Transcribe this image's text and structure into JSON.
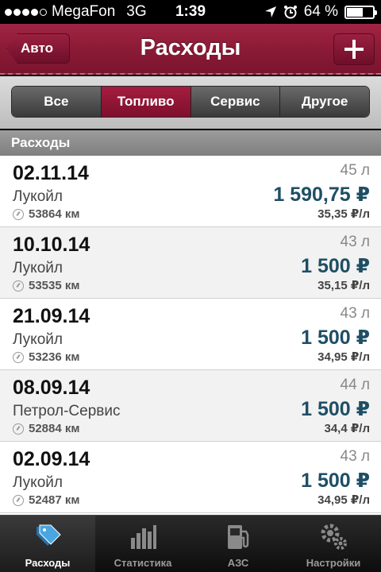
{
  "status_bar": {
    "carrier": "MegaFon",
    "network": "3G",
    "time": "1:39",
    "battery": "64 %",
    "battery_level": 0.64,
    "signal_bars": 4
  },
  "nav": {
    "back_label": "Авто",
    "title": "Расходы",
    "add_icon": "plus-icon"
  },
  "segments": [
    {
      "label": "Все",
      "active": false
    },
    {
      "label": "Топливо",
      "active": true
    },
    {
      "label": "Сервис",
      "active": false
    },
    {
      "label": "Другое",
      "active": false
    }
  ],
  "section_header": "Расходы",
  "expenses": [
    {
      "date": "02.11.14",
      "station": "Лукойл",
      "odometer": "53864 км",
      "volume": "45 л",
      "amount": "1 590,75 ₽",
      "price": "35,35 ₽/л"
    },
    {
      "date": "10.10.14",
      "station": "Лукойл",
      "odometer": "53535 км",
      "volume": "43 л",
      "amount": "1 500 ₽",
      "price": "35,15 ₽/л"
    },
    {
      "date": "21.09.14",
      "station": "Лукойл",
      "odometer": "53236 км",
      "volume": "43 л",
      "amount": "1 500 ₽",
      "price": "34,95 ₽/л"
    },
    {
      "date": "08.09.14",
      "station": "Петрол-Сервис",
      "odometer": "52884 км",
      "volume": "44 л",
      "amount": "1 500 ₽",
      "price": "34,4 ₽/л"
    },
    {
      "date": "02.09.14",
      "station": "Лукойл",
      "odometer": "52487 км",
      "volume": "43 л",
      "amount": "1 500 ₽",
      "price": "34,95 ₽/л"
    }
  ],
  "tabs": [
    {
      "label": "Расходы",
      "icon": "tags-icon",
      "active": true
    },
    {
      "label": "Статистика",
      "icon": "bar-chart-icon",
      "active": false
    },
    {
      "label": "АЗС",
      "icon": "fuel-pump-icon",
      "active": false
    },
    {
      "label": "Настройки",
      "icon": "gears-icon",
      "active": false
    }
  ],
  "colors": {
    "accent": "#8a1a35",
    "amount": "#1e4f64"
  }
}
